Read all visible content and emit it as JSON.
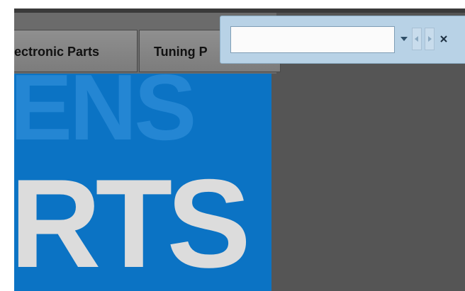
{
  "nav": {
    "items": [
      {
        "label": "lectronic Parts"
      },
      {
        "label": "Tuning P"
      }
    ]
  },
  "hero": {
    "ghost_text": "ENS",
    "main_text": "RTS"
  },
  "find_bar": {
    "value": "",
    "placeholder": "",
    "icons": {
      "dropdown": "chevron-down-icon",
      "previous": "chevron-left-icon",
      "next": "chevron-right-icon",
      "close": "close-icon"
    }
  },
  "colors": {
    "hero_blue": "#0b73c4",
    "hero_ghost": "#2486d3",
    "nav_bg": "#6b6b6b",
    "find_bar_bg": "#b8d2e6",
    "app_bg": "#555555"
  }
}
